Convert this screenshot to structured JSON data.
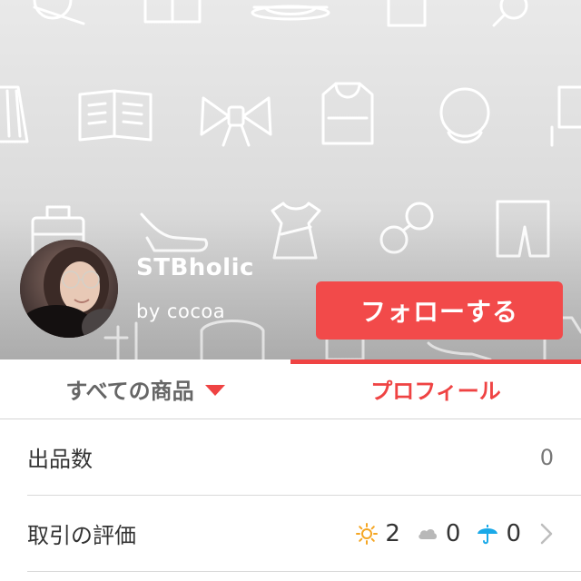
{
  "shop": {
    "name": "STBholic",
    "owner": "by cocoa"
  },
  "follow_button": {
    "label": "フォローする"
  },
  "tabs": [
    {
      "label": "すべての商品",
      "icon": "caret-down-icon",
      "active": false
    },
    {
      "label": "プロフィール",
      "active": true
    }
  ],
  "stats": {
    "listing_count_label": "出品数",
    "listing_count": "0",
    "rating_label": "取引の評価",
    "ratings": [
      {
        "icon": "sun-icon",
        "count": "2"
      },
      {
        "icon": "cloud-icon",
        "count": "0"
      },
      {
        "icon": "umbrella-icon",
        "count": "0"
      }
    ]
  },
  "colors": {
    "accent": "#ef4343",
    "sun": "#f5a623",
    "cloud": "#b8b8b8",
    "umbrella": "#1aa9e8"
  }
}
